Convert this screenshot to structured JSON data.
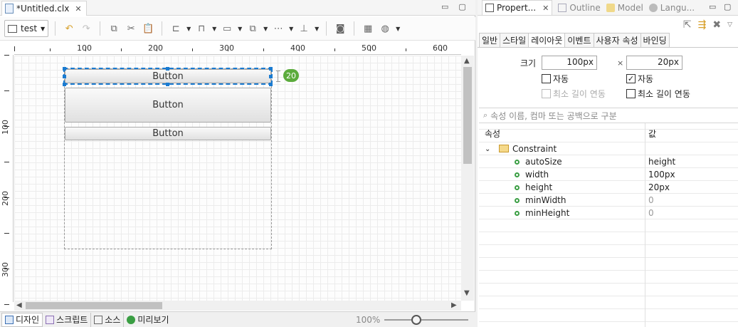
{
  "editor": {
    "tab_title": "*Untitled.clx",
    "tab_close": "✕",
    "minimize": "▭",
    "maximize": "▢",
    "toolbar": {
      "combo_value": "test"
    },
    "ruler_h": [
      "100",
      "200",
      "300",
      "400",
      "500",
      "600"
    ],
    "ruler_v": [
      "100",
      "200",
      "300"
    ],
    "canvas": {
      "buttons": [
        "Button",
        "Button",
        "Button"
      ],
      "height_badge": "20"
    },
    "bottom_tabs": [
      "디자인",
      "스크립트",
      "소스",
      "미리보기"
    ],
    "zoom_level": "100%",
    "zoom_slider_fraction": 0.38
  },
  "props": {
    "tabs": [
      "Propert...",
      "Outline",
      "Model",
      "Langu..."
    ],
    "tab_close": "✕",
    "category_tabs": [
      "일반",
      "스타일",
      "레이아웃",
      "이벤트",
      "사용자 속성",
      "바인딩"
    ],
    "active_category": "레이아웃",
    "size_label": "크기",
    "times": "×",
    "width_value": "100px",
    "height_value": "20px",
    "auto_left": {
      "label": "자동",
      "checked": false
    },
    "auto_right": {
      "label": "자동",
      "checked": true
    },
    "minlen_left": {
      "label": "최소 길이 연동",
      "checked": false,
      "disabled": true
    },
    "minlen_right": {
      "label": "최소 길이 연동",
      "checked": false,
      "disabled": false
    },
    "search_placeholder": "속성 이름, 컴마 또는 공백으로 구분",
    "table": {
      "col_property": "속성",
      "col_value": "값",
      "group": "Constraint",
      "rows": [
        {
          "name": "autoSize",
          "value": "height"
        },
        {
          "name": "width",
          "value": "100px"
        },
        {
          "name": "height",
          "value": "20px"
        },
        {
          "name": "minWidth",
          "value": "0"
        },
        {
          "name": "minHeight",
          "value": "0"
        }
      ]
    }
  },
  "colors": {
    "selection": "#1a7bd1",
    "badge": "#5bab3c",
    "property_dot": "#3a9e43"
  }
}
